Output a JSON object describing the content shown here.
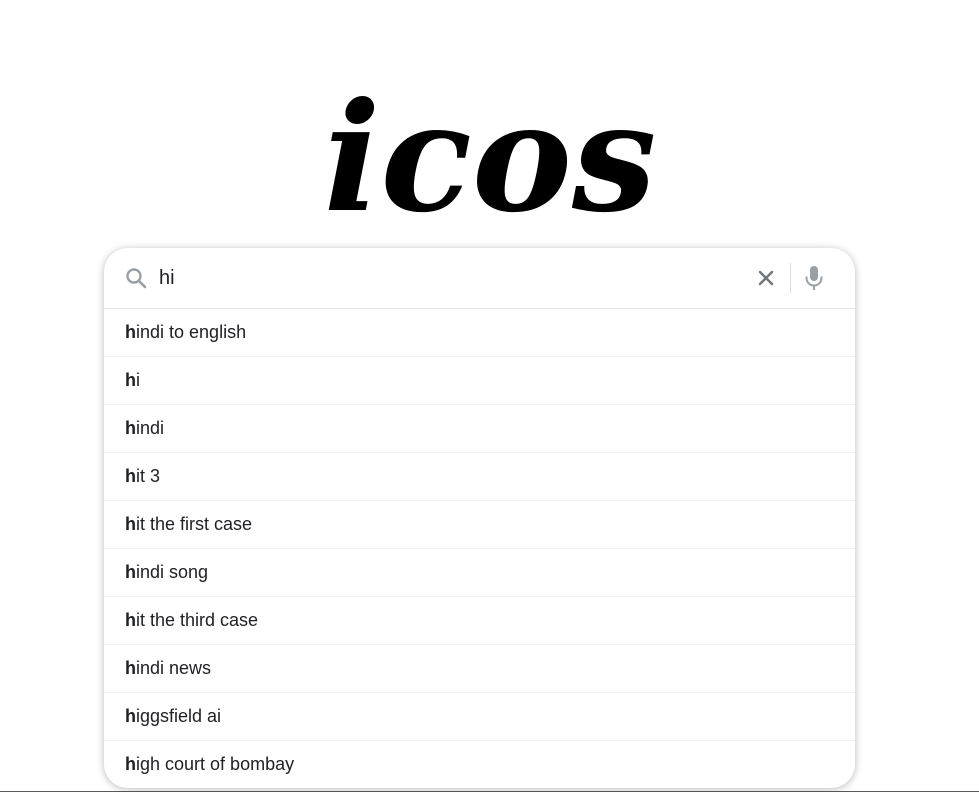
{
  "logo": {
    "text": "icos"
  },
  "search": {
    "value": "hi",
    "typed_prefix": "h"
  },
  "icons": {
    "search": "search-icon",
    "clear": "close-icon",
    "mic": "microphone-icon"
  },
  "suggestions": [
    {
      "prefix": "h",
      "rest": "indi to english"
    },
    {
      "prefix": "h",
      "rest": "i"
    },
    {
      "prefix": "h",
      "rest": "indi"
    },
    {
      "prefix": "h",
      "rest": "it 3"
    },
    {
      "prefix": "h",
      "rest": "it the first case"
    },
    {
      "prefix": "h",
      "rest": "indi song"
    },
    {
      "prefix": "h",
      "rest": "it the third case"
    },
    {
      "prefix": "h",
      "rest": "indi news"
    },
    {
      "prefix": "h",
      "rest": "iggsfield ai"
    },
    {
      "prefix": "h",
      "rest": "igh court of bombay"
    }
  ],
  "colors": {
    "icon_gray": "#757575",
    "text": "#202124"
  }
}
